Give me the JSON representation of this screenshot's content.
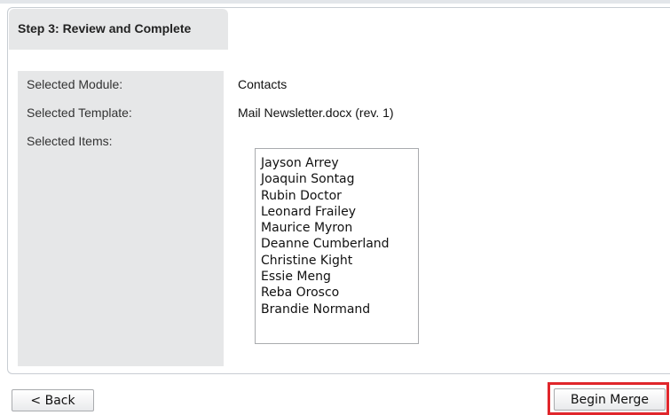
{
  "wizard": {
    "step_title": "Step 3: Review and Complete"
  },
  "fields": {
    "module_label": "Selected Module:",
    "module_value": "Contacts",
    "template_label": "Selected Template:",
    "template_value": "Mail Newsletter.docx (rev. 1)",
    "items_label": "Selected Items:"
  },
  "selected_items": [
    "Jayson Arrey",
    "Joaquin Sontag",
    "Rubin Doctor",
    "Leonard Frailey",
    "Maurice Myron",
    "Deanne Cumberland",
    "Christine Kight",
    "Essie Meng",
    "Reba Orosco",
    "Brandie Normand"
  ],
  "buttons": {
    "back_label": "< Back",
    "merge_label": "Begin Merge"
  },
  "colors": {
    "highlight": "#e0262b",
    "label_column": "#e6e7e8"
  }
}
